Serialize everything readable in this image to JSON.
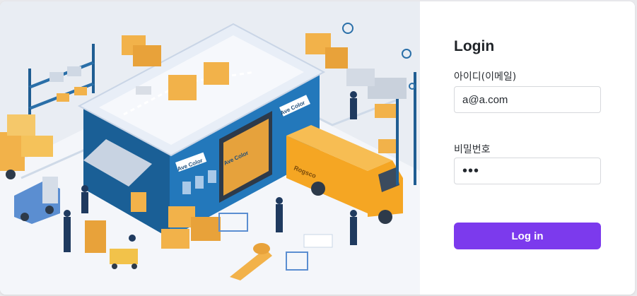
{
  "login": {
    "title": "Login",
    "id_label": "아이디(이메일)",
    "id_value": "a@a.com",
    "password_label": "비밀번호",
    "password_value": "abc",
    "submit_label": "Log in"
  },
  "illustration": {
    "sign_warehouse_front": "Ave Color",
    "sign_warehouse_side": "Ave Color",
    "sign_dock": "Ave Color",
    "truck_label": "Rogsco"
  },
  "colors": {
    "accent": "#7c3aed",
    "warehouse_blue": "#1f6fae",
    "box_orange": "#f2b24a",
    "truck_orange": "#f5a623"
  }
}
